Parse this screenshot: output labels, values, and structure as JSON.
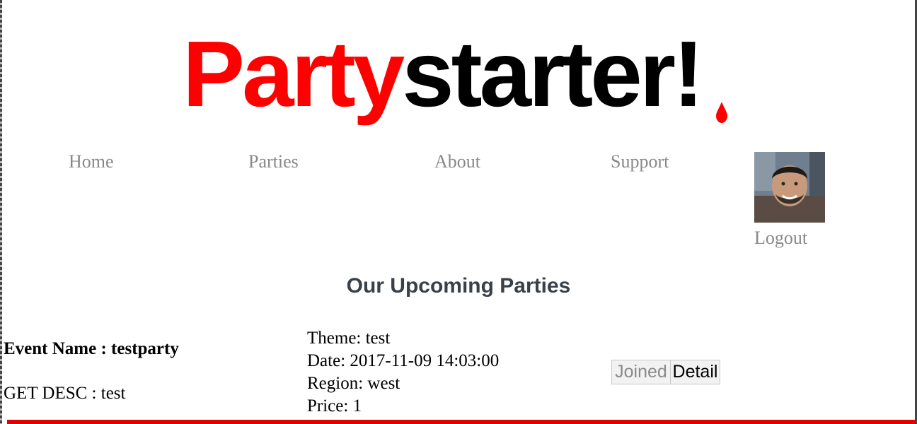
{
  "logo": {
    "part1": "Party",
    "part2": "starter!",
    "colors": {
      "primary": "#ff0000",
      "secondary": "#000000"
    }
  },
  "nav": {
    "home": "Home",
    "parties": "Parties",
    "about": "About",
    "support": "Support",
    "logout": "Logout"
  },
  "section": {
    "title": "Our Upcoming Parties"
  },
  "events": [
    {
      "name_label": "Event Name : testparty",
      "desc_label": "GET DESC : test",
      "theme": "Theme: test",
      "date": "Date: 2017-11-09 14:03:00",
      "region": "Region: west",
      "price": "Price: 1",
      "joined_label": "Joined",
      "detail_label": "Detail"
    }
  ],
  "colors": {
    "nav_text": "#888888",
    "title_text": "#3a4048",
    "accent_bar": "#e00000"
  }
}
